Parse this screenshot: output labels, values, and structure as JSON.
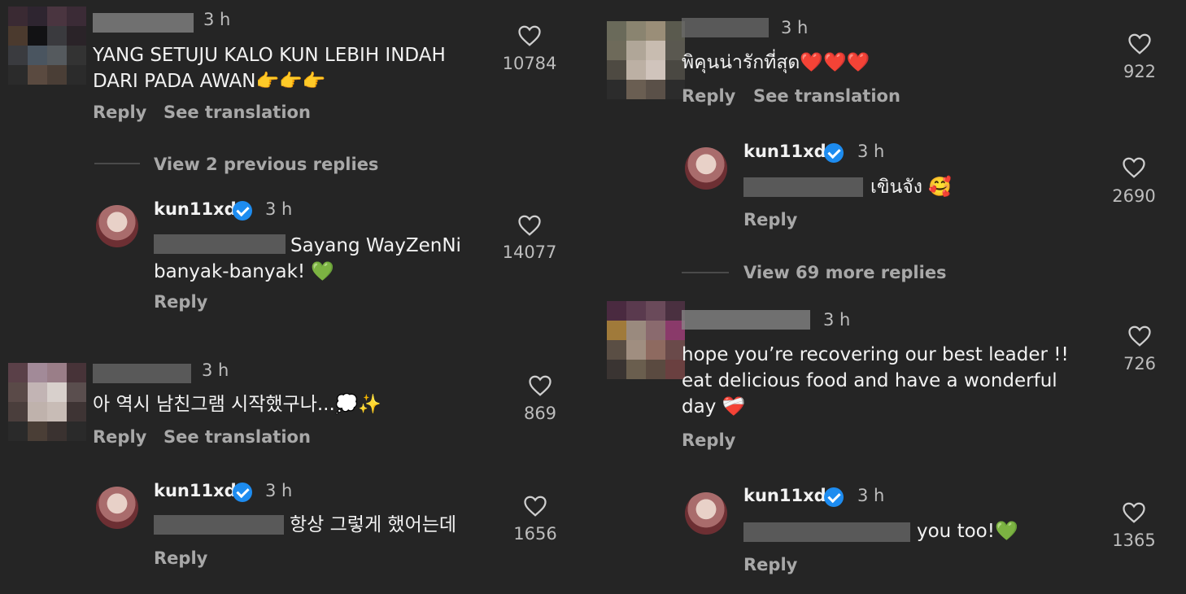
{
  "comments": [
    {
      "time": "3 h",
      "text": "YANG SETUJU KALO KUN LEBIH INDAH\nDARI PADA AWAN👉👉👉",
      "likes": "10784",
      "reply_label": "Reply",
      "translate_label": "See translation"
    },
    {
      "view_replies": "View 2 previous replies"
    },
    {
      "username": "kun11xd",
      "time": "3 h",
      "text_after_mention": "Sayang WayZenNi\nbanyak-banyak! 💚",
      "likes": "14077",
      "reply_label": "Reply"
    },
    {
      "time": "3 h",
      "text": "아 역시 남친그램 시작했구나...💭✨",
      "likes": "869",
      "reply_label": "Reply",
      "translate_label": "See translation"
    },
    {
      "username": "kun11xd",
      "time": "3 h",
      "text_after_mention": "항상 그렇게 했어는데",
      "likes": "1656",
      "reply_label": "Reply"
    }
  ],
  "right": [
    {
      "time": "3 h",
      "text": "พิคุนน่ารักที่สุด❤️❤️❤️",
      "likes": "922",
      "reply_label": "Reply",
      "translate_label": "See translation"
    },
    {
      "username": "kun11xd",
      "time": "3 h",
      "text_after_mention": "เขินจัง 🥰",
      "likes": "2690",
      "reply_label": "Reply"
    },
    {
      "view_replies": "View 69 more replies"
    },
    {
      "time": "3 h",
      "text": "hope you’re recovering our best leader !!\neat delicious food and have a wonderful\nday ❤️‍🩹",
      "likes": "726",
      "reply_label": "Reply"
    },
    {
      "username": "kun11xd",
      "time": "3 h",
      "text_after_mention": "you too!💚",
      "likes": "1365",
      "reply_label": "Reply"
    }
  ],
  "icons": {
    "heart": "heart-outline-icon",
    "verified": "verified-badge-icon"
  },
  "colors": {
    "background": "#252525",
    "text": "#f2f2f2",
    "muted": "#a8a8a8",
    "verified": "#1d8cf0"
  }
}
